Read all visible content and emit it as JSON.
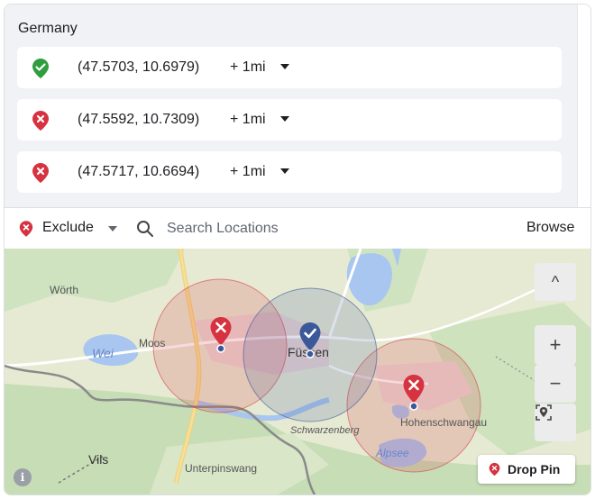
{
  "country": "Germany",
  "locations": [
    {
      "status": "include",
      "icon": "check-pin-icon",
      "coord": "(47.5703, 10.6979)",
      "radius": "+ 1mi"
    },
    {
      "status": "exclude",
      "icon": "x-pin-icon",
      "coord": "(47.5592, 10.7309)",
      "radius": "+ 1mi"
    },
    {
      "status": "exclude",
      "icon": "x-pin-icon",
      "coord": "(47.5717, 10.6694)",
      "radius": "+ 1mi"
    }
  ],
  "toolbar": {
    "mode_label": "Exclude",
    "search_placeholder": "Search Locations",
    "browse_label": "Browse"
  },
  "map": {
    "places": {
      "worth": "Wörth",
      "moos": "Moos",
      "weis": "Wei",
      "fussen": "Füssen",
      "schwarzenberg": "Schwarzenberg",
      "hohenschwangau": "Hohenschwangau",
      "alpsee": "Alpsee",
      "vils": "Vils",
      "unterpinswang": "Unterpinswang"
    },
    "controls": {
      "collapse": "^",
      "zoom_in": "+",
      "zoom_out": "−"
    },
    "drop_pin_label": "Drop Pin",
    "info_label": "i"
  },
  "colors": {
    "include": "#3b5998",
    "exclude": "#d6323f",
    "include_check": "#2e9e3e"
  }
}
